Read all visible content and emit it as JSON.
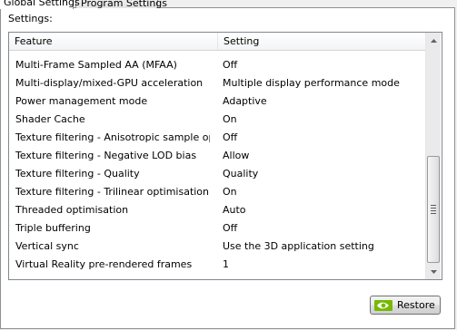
{
  "tabs": {
    "global": "Global Settings",
    "program": "Program Settings"
  },
  "settings_label": "Settings:",
  "table": {
    "columns": [
      "Feature",
      "Setting"
    ],
    "rows": [
      {
        "feature": "Multi-Frame Sampled AA (MFAA)",
        "setting": "Off"
      },
      {
        "feature": "Multi-display/mixed-GPU acceleration",
        "setting": "Multiple display performance mode"
      },
      {
        "feature": "Power management mode",
        "setting": "Adaptive"
      },
      {
        "feature": "Shader Cache",
        "setting": "On"
      },
      {
        "feature": "Texture filtering - Anisotropic sample opti...",
        "setting": "Off"
      },
      {
        "feature": "Texture filtering - Negative LOD bias",
        "setting": "Allow"
      },
      {
        "feature": "Texture filtering - Quality",
        "setting": "Quality"
      },
      {
        "feature": "Texture filtering - Trilinear optimisation",
        "setting": "On"
      },
      {
        "feature": "Threaded optimisation",
        "setting": "Auto"
      },
      {
        "feature": "Triple buffering",
        "setting": "Off"
      },
      {
        "feature": "Vertical sync",
        "setting": "Use the 3D application setting"
      },
      {
        "feature": "Virtual Reality pre-rendered frames",
        "setting": "1"
      }
    ]
  },
  "restore_button": {
    "label": "Restore",
    "icon": "nvidia-logo-icon"
  },
  "colors": {
    "nvidia_green": "#76b900"
  }
}
